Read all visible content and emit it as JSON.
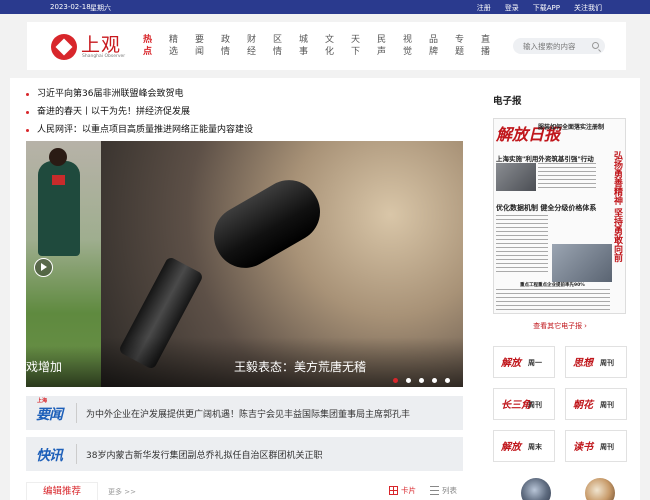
{
  "topbar": {
    "date": "2023-02-18",
    "weekday": "星期六",
    "links": [
      "注册",
      "登录",
      "下载APP",
      "关注我们"
    ]
  },
  "header": {
    "logo_text": "上观",
    "logo_sub": "Shanghai Observer",
    "nav": [
      {
        "l1": "热",
        "l2": "点",
        "active": true
      },
      {
        "l1": "精",
        "l2": "选"
      },
      {
        "l1": "要",
        "l2": "闻"
      },
      {
        "l1": "政",
        "l2": "情"
      },
      {
        "l1": "财",
        "l2": "经"
      },
      {
        "l1": "区",
        "l2": "情"
      },
      {
        "l1": "城",
        "l2": "事"
      },
      {
        "l1": "文",
        "l2": "化"
      },
      {
        "l1": "天",
        "l2": "下"
      },
      {
        "l1": "民",
        "l2": "声"
      },
      {
        "l1": "视",
        "l2": "觉"
      },
      {
        "l1": "品",
        "l2": "牌"
      },
      {
        "l1": "专",
        "l2": "题"
      },
      {
        "l1": "直",
        "l2": "播"
      }
    ],
    "search_placeholder": "输入搜索的内容"
  },
  "headlines": [
    "习近平向第36届非洲联盟峰会致贺电",
    "奋进的春天丨以干为先！拼经济促发展",
    "人民网评：以重点项目高质量推进网络正能量内容建设"
  ],
  "carousel": {
    "left_caption": "戏增加",
    "main_caption": "王毅表态：美方荒唐无稽",
    "slide_count": 5,
    "active_index": 0
  },
  "flash": [
    {
      "logo": "要闻",
      "logo_tag": "上海",
      "text": "为中外企业在沪发展提供更广阔机遇！陈吉宁会见丰益国际集团董事局主席郭孔丰"
    },
    {
      "logo": "快讯",
      "logo_tag": "",
      "text": "38岁内蒙古新华发行集团副总乔礼拟任自治区群团机关正职"
    }
  ],
  "editor": {
    "tab": "编辑推荐",
    "more": "更多 >>",
    "card_label": "卡片",
    "list_label": "列表"
  },
  "sidebar": {
    "title": "电子报",
    "paper": {
      "masthead": "解放日报",
      "top_headline": "服装如何全面落实注册制",
      "h1": "上海实施\"利用外资筑基引强\"行动",
      "h2": "优化数据机制 健全分级价格体系",
      "h3": "重点工程重点企业提前率先90%",
      "vertical": "弘扬勇善精神 坚持勇敢向前"
    },
    "other_link": "查看其它电子报",
    "weeklies": [
      {
        "logo": "解放",
        "sub": "周一"
      },
      {
        "logo": "思想",
        "sub": "周刊"
      },
      {
        "logo": "长三角",
        "sub": "周刊"
      },
      {
        "logo": "朝花",
        "sub": "周刊"
      },
      {
        "logo": "解放",
        "sub": "周末"
      },
      {
        "logo": "读书",
        "sub": "周刊"
      }
    ]
  },
  "colors": {
    "topbar": "#2a3a8e",
    "accent_red": "#d8262b",
    "flash_blue": "#1d5fb9"
  }
}
